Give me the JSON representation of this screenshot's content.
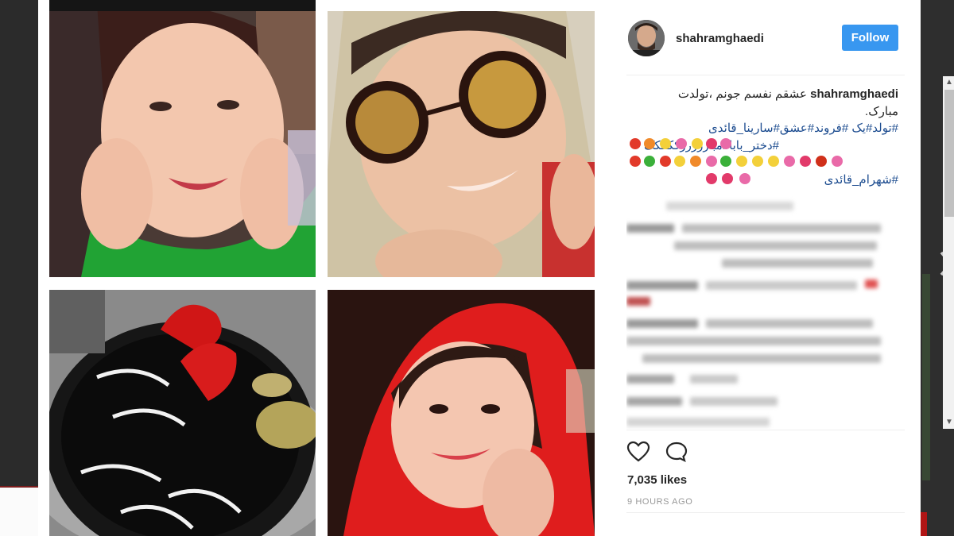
{
  "post": {
    "username": "shahramghaedi",
    "follow_label": "Follow",
    "caption_username": "shahramghaedi",
    "caption_lines": [
      "عشقم نفسم جونم ،تولدت",
      "مبارک.",
      "#تولد#یک #فروند#عشق#سارینا_قائدی",
      "#دختر_بابا#مبارررررککککک"
    ],
    "caption_last_line": "#شهرام_قائدی",
    "likes": "7,035 likes",
    "time_ago": "9 HOURS AGO"
  },
  "icons": {
    "like": "heart-icon",
    "comment": "comment-bubble-icon",
    "next": "chevron-right-icon",
    "scroll_up": "scroll-up-arrow-icon",
    "scroll_down": "scroll-down-arrow-icon"
  },
  "colors": {
    "follow_button": "#3897f0",
    "hashtag": "#1b4b8f",
    "text": "#262626",
    "muted": "#999999"
  }
}
